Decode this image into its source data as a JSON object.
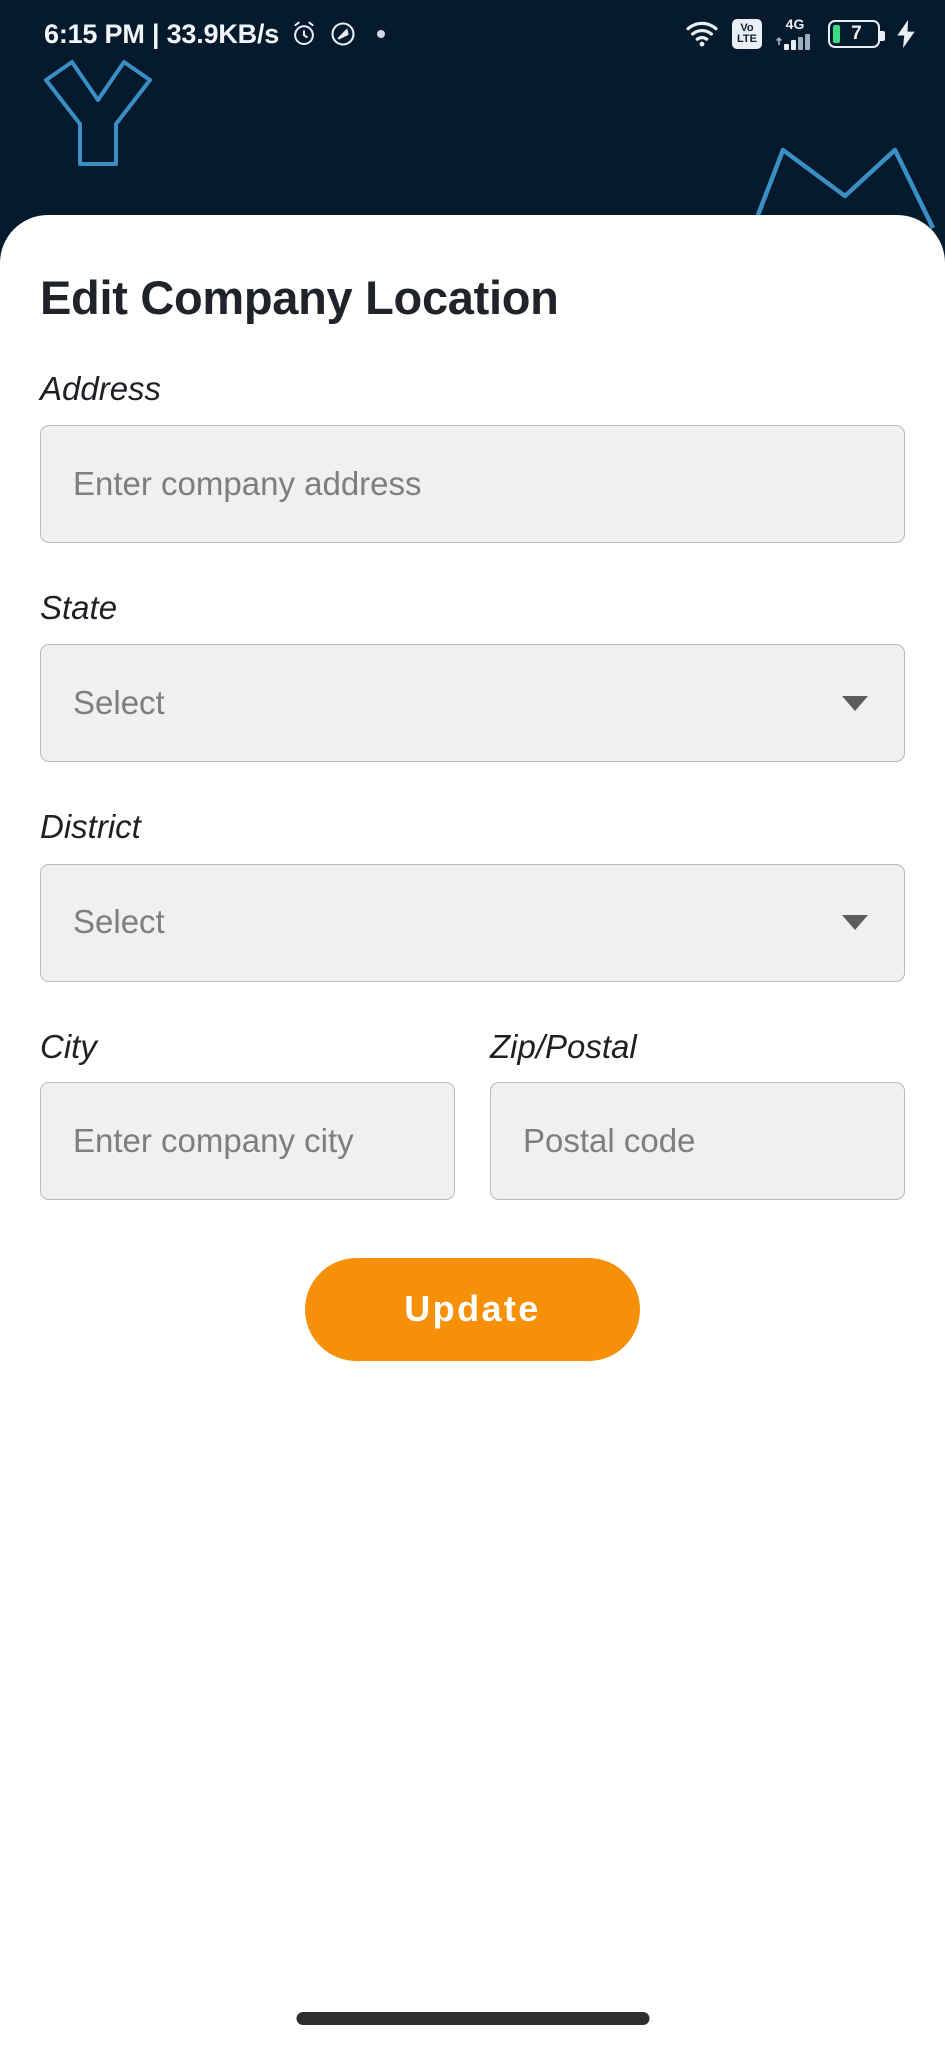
{
  "status_bar": {
    "clock": "6:15 PM | 33.9KB/s",
    "alarm_icon": "alarm-clock-icon",
    "dnd_icon": "do-not-disturb-icon",
    "wifi_icon": "wifi-icon",
    "volte_top": "Vo",
    "volte_bottom": "LTE",
    "network_type": "4G",
    "signal_icon": "signal-bars-icon",
    "battery_level": "7",
    "charging_icon": "charging-bolt-icon"
  },
  "header": {
    "decor_left": "y-shape-outline",
    "decor_right": "zigzag-crown-outline",
    "bg_color": "#051a2d",
    "decor_color": "#3a8fc4"
  },
  "page": {
    "title": "Edit Company Location"
  },
  "form": {
    "address": {
      "label": "Address",
      "placeholder": "Enter company address",
      "value": ""
    },
    "state": {
      "label": "State",
      "selected": "Select",
      "caret_icon": "chevron-down-icon"
    },
    "district": {
      "label": "District",
      "selected": "Select",
      "caret_icon": "chevron-down-icon"
    },
    "city": {
      "label": "City",
      "placeholder": "Enter company city",
      "value": ""
    },
    "zip": {
      "label": "Zip/Postal",
      "placeholder": "Postal code",
      "value": ""
    }
  },
  "actions": {
    "update_label": "Update",
    "accent_color": "#f79009"
  },
  "system": {
    "gesture_bar": "home-gesture-indicator"
  }
}
